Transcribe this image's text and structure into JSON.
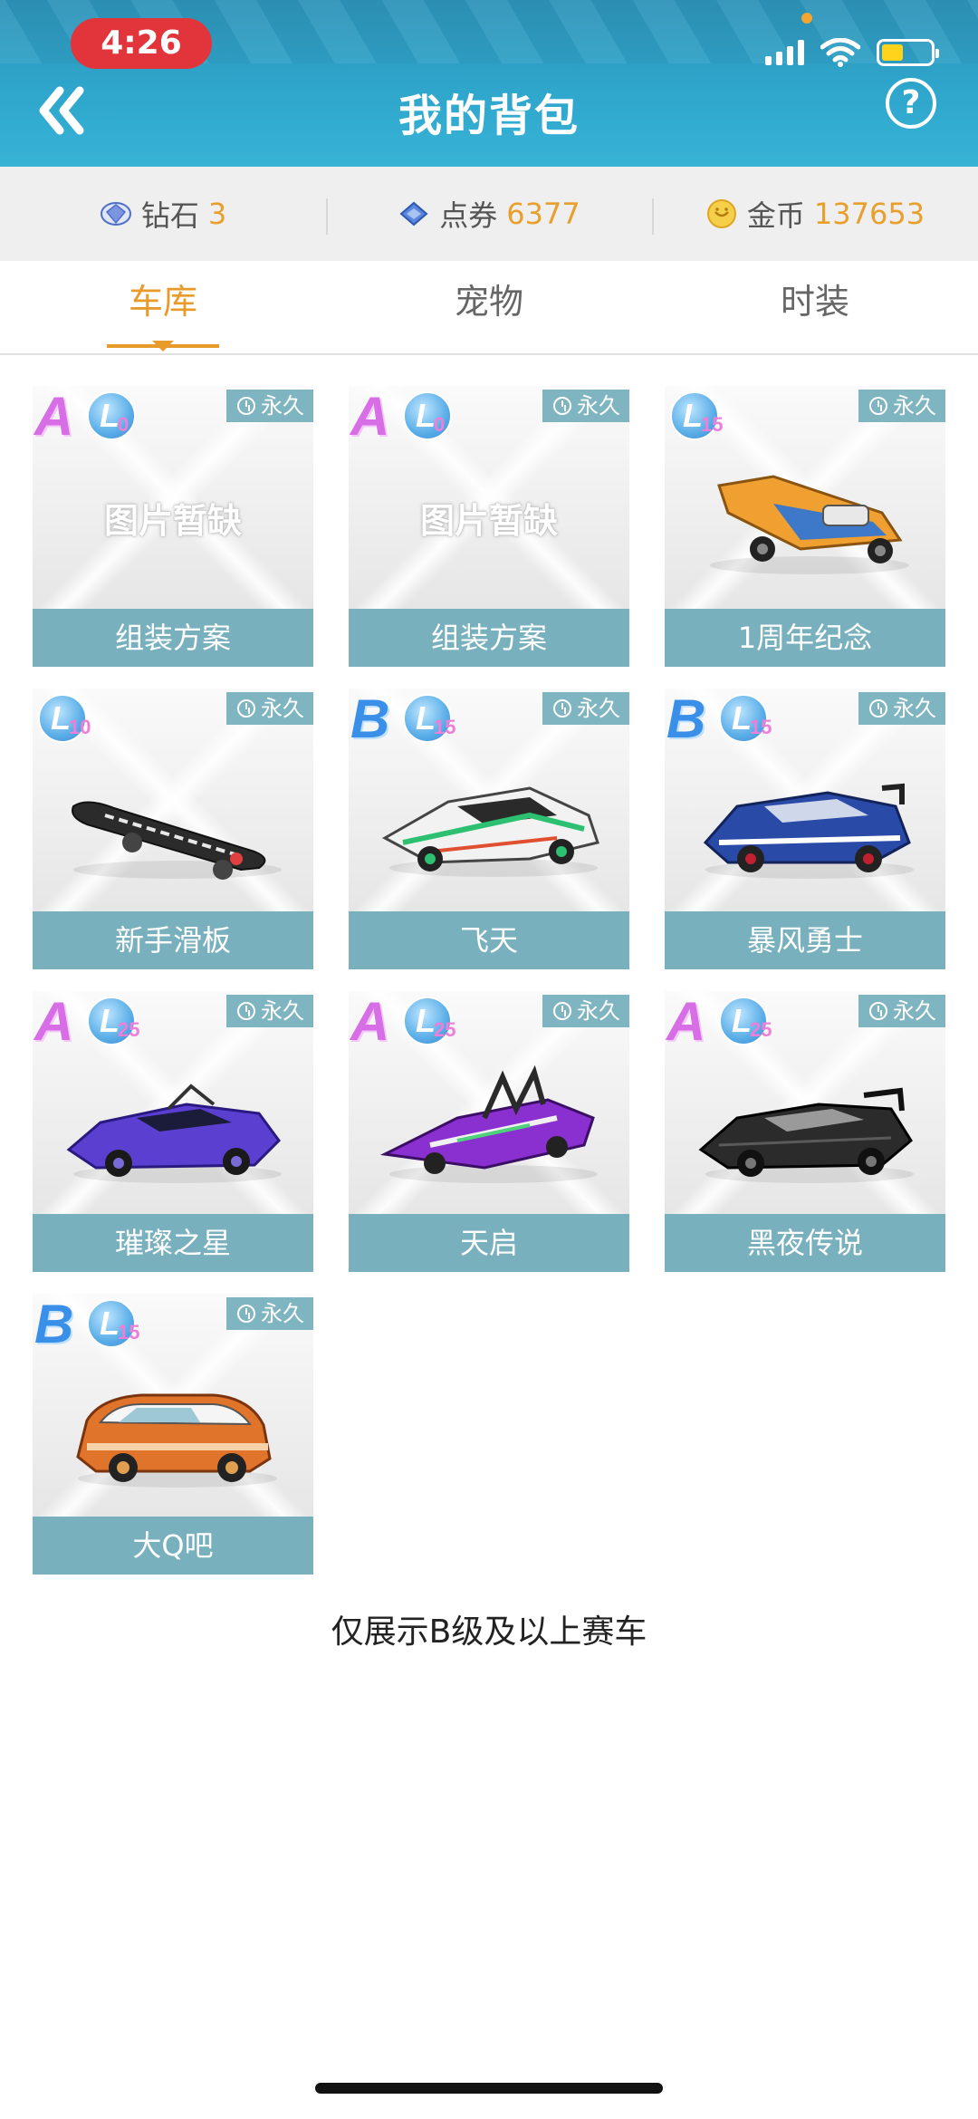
{
  "status_bar": {
    "time": "4:26"
  },
  "header": {
    "title": "我的背包",
    "help_label": "?"
  },
  "currencies": [
    {
      "label": "钻石",
      "value": "3",
      "icon": "diamond-icon",
      "color": "#4f6fc7"
    },
    {
      "label": "点券",
      "value": "6377",
      "icon": "voucher-icon",
      "color": "#3d69c9"
    },
    {
      "label": "金币",
      "value": "137653",
      "icon": "coin-icon",
      "color": "#f2c13b"
    }
  ],
  "tabs": [
    {
      "label": "车库",
      "active": true
    },
    {
      "label": "宠物",
      "active": false
    },
    {
      "label": "时装",
      "active": false
    }
  ],
  "items": [
    {
      "name": "组装方案",
      "grade": "A",
      "level": "0",
      "duration": "永久",
      "image": "missing",
      "missing_text": "图片暂缺"
    },
    {
      "name": "组装方案",
      "grade": "A",
      "level": "0",
      "duration": "永久",
      "image": "missing",
      "missing_text": "图片暂缺"
    },
    {
      "name": "1周年纪念",
      "grade": "",
      "level": "15",
      "duration": "永久",
      "image": "kart-orange"
    },
    {
      "name": "新手滑板",
      "grade": "",
      "level": "10",
      "duration": "永久",
      "image": "skateboard"
    },
    {
      "name": "飞天",
      "grade": "B",
      "level": "15",
      "duration": "永久",
      "image": "car-white-green"
    },
    {
      "name": "暴风勇士",
      "grade": "B",
      "level": "15",
      "duration": "永久",
      "image": "car-blue-white"
    },
    {
      "name": "璀璨之星",
      "grade": "A",
      "level": "25",
      "duration": "永久",
      "image": "car-purple"
    },
    {
      "name": "天启",
      "grade": "A",
      "level": "25",
      "duration": "永久",
      "image": "car-purple-spiky"
    },
    {
      "name": "黑夜传说",
      "grade": "A",
      "level": "25",
      "duration": "永久",
      "image": "car-black"
    },
    {
      "name": "大Q吧",
      "grade": "B",
      "level": "15",
      "duration": "永久",
      "image": "car-mini-orange"
    }
  ],
  "footer_note": "仅展示B级及以上赛车",
  "colors": {
    "accent": "#e89b2a",
    "card_label_bg": "#79b0be",
    "header_bg": "#2fa6cc"
  }
}
